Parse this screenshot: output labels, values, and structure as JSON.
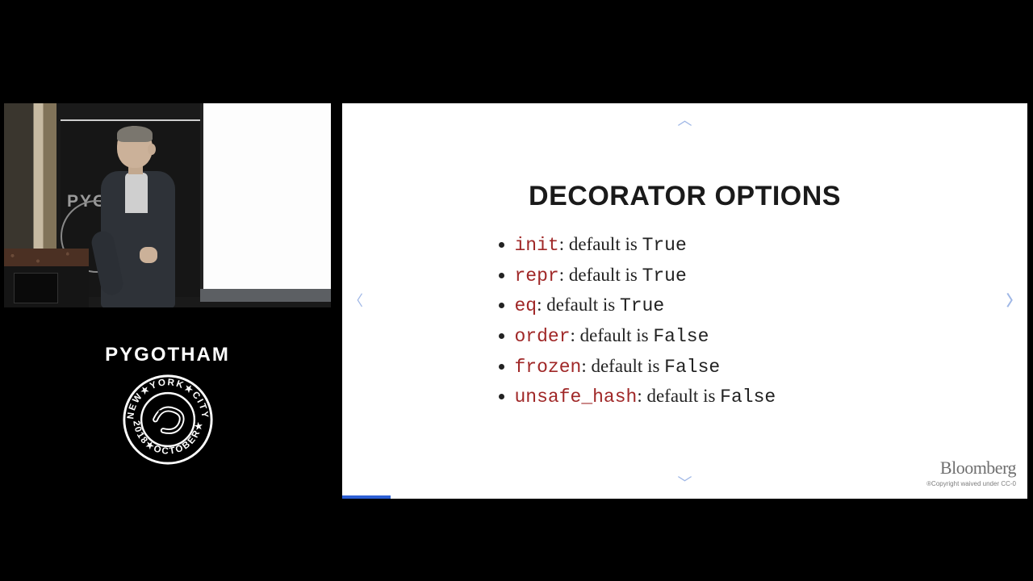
{
  "event": {
    "name": "PYGOTHAM",
    "seal_top": "NEW★YORK★CITY",
    "seal_bottom": "2018★OCTOBER★",
    "banner_text": "PYG    HAM"
  },
  "slide": {
    "title": "DECORATOR OPTIONS",
    "bullets": [
      {
        "kw": "init",
        "mid": ": default is ",
        "val": "True"
      },
      {
        "kw": "repr",
        "mid": ": default is ",
        "val": "True"
      },
      {
        "kw": "eq",
        "mid": ": default is ",
        "val": "True"
      },
      {
        "kw": "order",
        "mid": ": default is ",
        "val": "False"
      },
      {
        "kw": "frozen",
        "mid": ": default is ",
        "val": "False"
      },
      {
        "kw": "unsafe_hash",
        "mid": ": default is ",
        "val": "False"
      }
    ],
    "nav": {
      "up": "︿",
      "down": "﹀",
      "left": "〈",
      "right": "〉"
    },
    "footer": {
      "brand": "Bloomberg",
      "sub": "®Copyright waived under CC-0"
    }
  }
}
